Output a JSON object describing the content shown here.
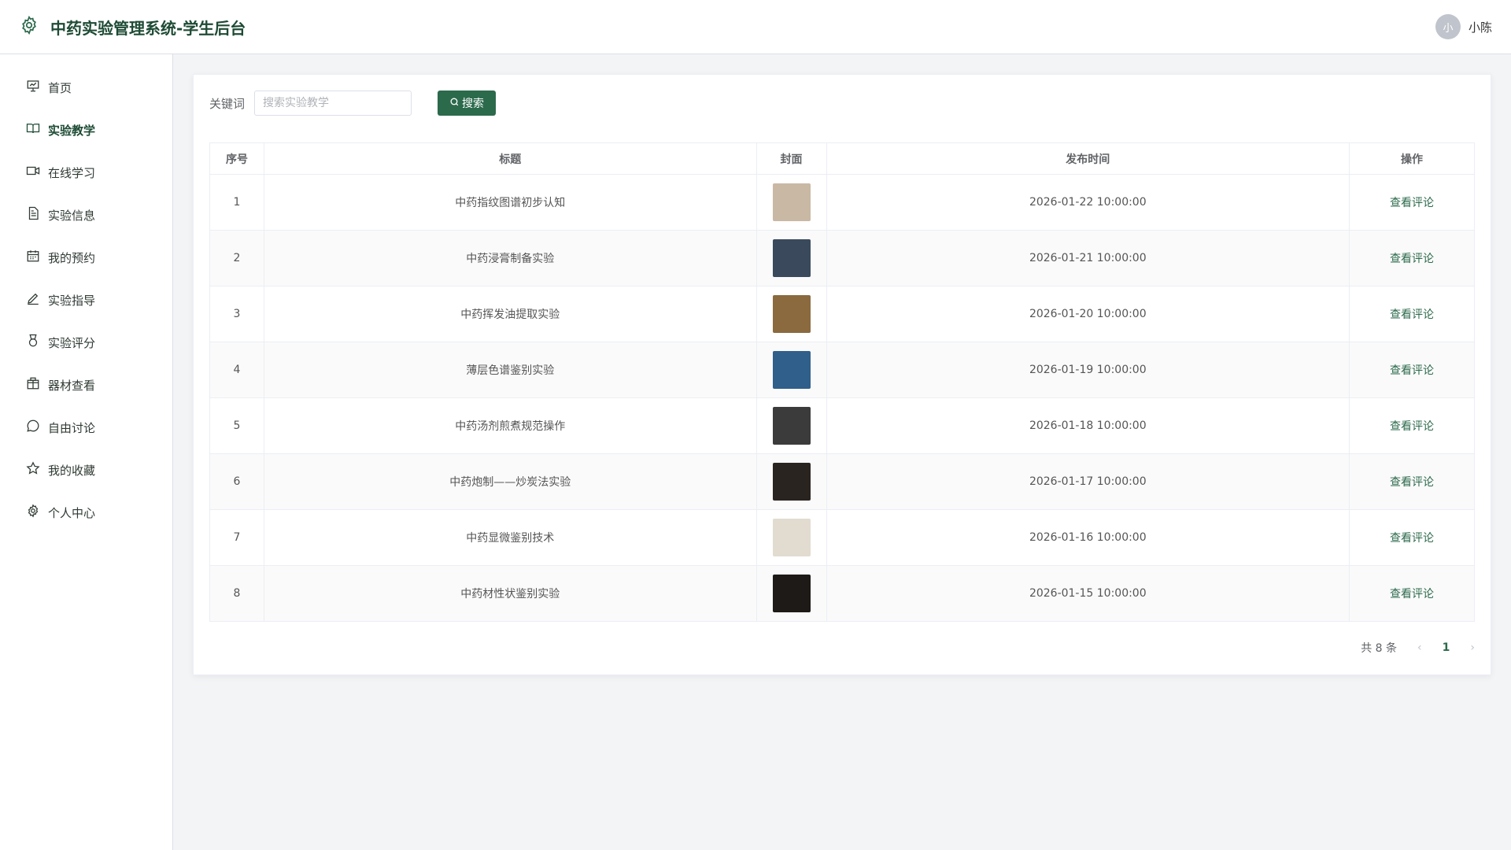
{
  "app": {
    "title": "中药实验管理系统-学生后台"
  },
  "user": {
    "avatar_text": "小",
    "name": "小陈"
  },
  "sidebar": {
    "items": [
      {
        "label": "首页",
        "icon": "presentation-icon",
        "active": false
      },
      {
        "label": "实验教学",
        "icon": "book-icon",
        "active": true
      },
      {
        "label": "在线学习",
        "icon": "video-camera-icon",
        "active": false
      },
      {
        "label": "实验信息",
        "icon": "document-icon",
        "active": false
      },
      {
        "label": "我的预约",
        "icon": "calendar-icon",
        "active": false
      },
      {
        "label": "实验指导",
        "icon": "pen-icon",
        "active": false
      },
      {
        "label": "实验评分",
        "icon": "medal-icon",
        "active": false
      },
      {
        "label": "器材查看",
        "icon": "box-icon",
        "active": false
      },
      {
        "label": "自由讨论",
        "icon": "chat-icon",
        "active": false
      },
      {
        "label": "我的收藏",
        "icon": "star-icon",
        "active": false
      },
      {
        "label": "个人中心",
        "icon": "gear-icon",
        "active": false
      }
    ]
  },
  "search": {
    "label": "关键词",
    "placeholder": "搜索实验教学",
    "value": "",
    "button_label": "搜索"
  },
  "table": {
    "headers": [
      "序号",
      "标题",
      "封面",
      "发布时间",
      "操作"
    ],
    "rows": [
      {
        "index": "1",
        "title": "中药指纹图谱初步认知",
        "published": "2026-01-22 10:00:00",
        "action": "查看评论",
        "cover_color": "#c9b8a4"
      },
      {
        "index": "2",
        "title": "中药浸膏制备实验",
        "published": "2026-01-21 10:00:00",
        "action": "查看评论",
        "cover_color": "#3a4a5c"
      },
      {
        "index": "3",
        "title": "中药挥发油提取实验",
        "published": "2026-01-20 10:00:00",
        "action": "查看评论",
        "cover_color": "#8a6a3e"
      },
      {
        "index": "4",
        "title": "薄层色谱鉴别实验",
        "published": "2026-01-19 10:00:00",
        "action": "查看评论",
        "cover_color": "#2f5f8a"
      },
      {
        "index": "5",
        "title": "中药汤剂煎煮规范操作",
        "published": "2026-01-18 10:00:00",
        "action": "查看评论",
        "cover_color": "#3b3b3b"
      },
      {
        "index": "6",
        "title": "中药炮制——炒炭法实验",
        "published": "2026-01-17 10:00:00",
        "action": "查看评论",
        "cover_color": "#2a2420"
      },
      {
        "index": "7",
        "title": "中药显微鉴别技术",
        "published": "2026-01-16 10:00:00",
        "action": "查看评论",
        "cover_color": "#e2dbd0"
      },
      {
        "index": "8",
        "title": "中药材性状鉴别实验",
        "published": "2026-01-15 10:00:00",
        "action": "查看评论",
        "cover_color": "#1d1a17"
      }
    ]
  },
  "pagination": {
    "total_text": "共 8 条",
    "current_page": "1",
    "prev": "‹",
    "next": "›"
  },
  "colors": {
    "brand": "#1e4b35",
    "primary": "#2c6a4c"
  }
}
